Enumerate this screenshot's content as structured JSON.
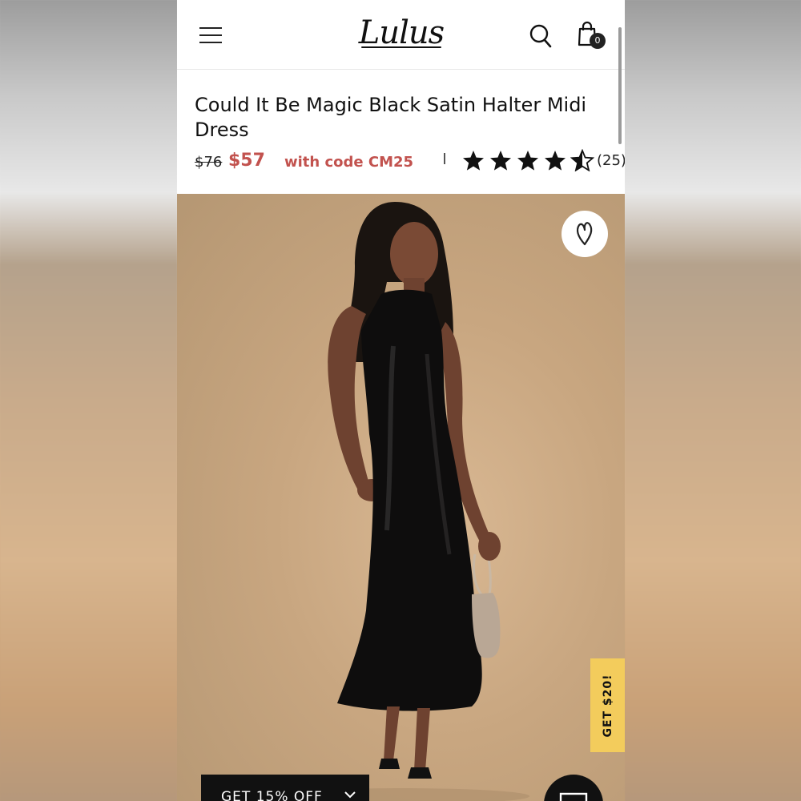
{
  "header": {
    "logo_text": "Lulus",
    "cart_count": "0"
  },
  "product": {
    "title": "Could It Be Magic Black Satin Halter Midi Dress",
    "original_price": "$76",
    "sale_price": "$57",
    "code_text": "with code CM25",
    "rating": 4.5,
    "rating_max": 5,
    "review_count": "(25)"
  },
  "promo": {
    "side_tab_label": "GET $20!",
    "offer_bar_label": "GET 15% OFF"
  },
  "colors": {
    "price_accent": "#c2524e",
    "promo_tab": "#f3cc5c",
    "dark": "#111111"
  },
  "icons": [
    "menu-icon",
    "search-icon",
    "shopping-bag-icon",
    "star-icon",
    "heart-icon",
    "close-icon",
    "chat-icon"
  ]
}
